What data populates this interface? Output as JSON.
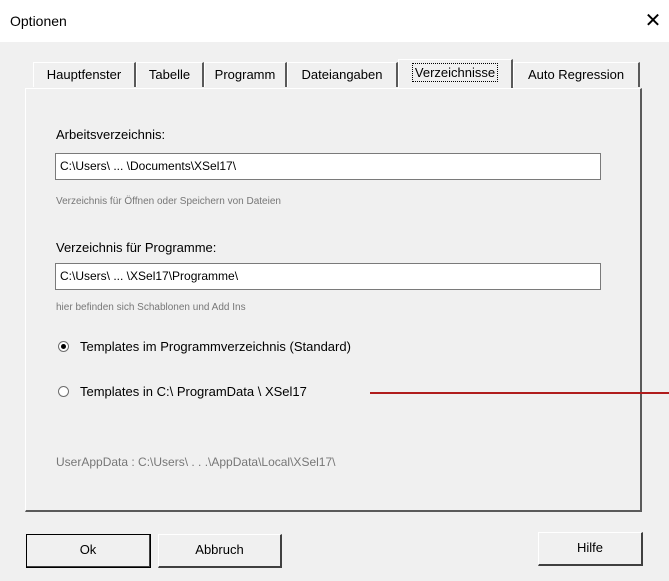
{
  "window": {
    "title": "Optionen",
    "close_label": "✕"
  },
  "tabs": [
    {
      "label": "Hauptfenster"
    },
    {
      "label": "Tabelle"
    },
    {
      "label": "Programm"
    },
    {
      "label": "Dateiangaben"
    },
    {
      "label": "Verzeichnisse",
      "active": true
    },
    {
      "label": "Auto Regression"
    }
  ],
  "work_dir": {
    "label": "Arbeitsverzeichnis:",
    "value": "C:\\Users\\ ... \\Documents\\XSel17\\",
    "hint": "Verzeichnis für Öffnen oder Speichern von Dateien"
  },
  "prog_dir": {
    "label": "Verzeichnis für Programme:",
    "value": "C:\\Users\\ ... \\XSel17\\Programme\\",
    "hint": "hier befinden sich Schablonen und Add Ins"
  },
  "templates": {
    "options": [
      {
        "label": "Templates im Programmverzeichnis (Standard)",
        "selected": true
      },
      {
        "label": "Templates in C:\\ ProgramData \\ XSel17",
        "selected": false
      }
    ]
  },
  "userappdata": "UserAppData :  C:\\Users\\ . . .\\AppData\\Local\\XSel17\\",
  "buttons": {
    "ok": "Ok",
    "cancel": "Abbruch",
    "help": "Hilfe"
  },
  "colors": {
    "annotation_line": "#b01c1c",
    "hint_text": "#777777"
  }
}
